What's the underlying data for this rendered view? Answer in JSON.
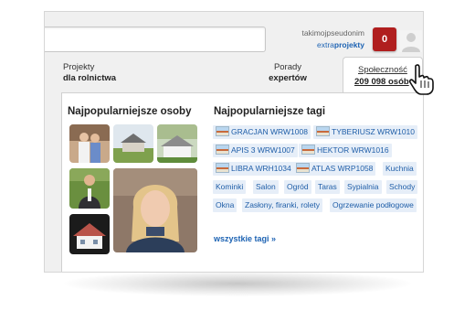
{
  "user": {
    "nickname": "takimojpseudonim",
    "projects_prefix": "extra",
    "projects_bold": "projekty",
    "notifications_count": "0"
  },
  "nav": {
    "projekty_line1": "Projekty",
    "projekty_line2": "dla rolnictwa",
    "porady_line1": "Porady",
    "porady_line2": "expertów",
    "spolecznosc_line1": "Społeczność",
    "spolecznosc_line2": "209 098 osób"
  },
  "dropdown": {
    "people_heading": "Najpopularniejsze osoby",
    "tags_heading": "Najpopularniejsze tagi",
    "all_tags_link": "wszystkie tagi »",
    "tags": [
      {
        "label": "GRACJAN WRW1008",
        "thumb": true
      },
      {
        "label": "TYBERIUSZ WRW1010",
        "thumb": true
      },
      {
        "label": "APIS 3 WRW1007",
        "thumb": true
      },
      {
        "label": "HEKTOR WRW1016",
        "thumb": true
      },
      {
        "label": "LIBRA WRH1034",
        "thumb": true
      },
      {
        "label": "ATLAS WRP1058",
        "thumb": true
      },
      {
        "label": "Kuchnia",
        "thumb": false
      },
      {
        "label": "Kominki",
        "thumb": false
      },
      {
        "label": "Salon",
        "thumb": false
      },
      {
        "label": "Ogród",
        "thumb": false
      },
      {
        "label": "Taras",
        "thumb": false
      },
      {
        "label": "Sypialnia",
        "thumb": false
      },
      {
        "label": "Schody",
        "thumb": false
      },
      {
        "label": "Okna",
        "thumb": false
      },
      {
        "label": "Zasłony, firanki, rolety",
        "thumb": false
      },
      {
        "label": "Ogrzewanie podłogowe",
        "thumb": false
      }
    ]
  },
  "colors": {
    "accent_link": "#1d63b3",
    "badge_red": "#b01e1e",
    "tag_bg": "#e6eef8"
  }
}
